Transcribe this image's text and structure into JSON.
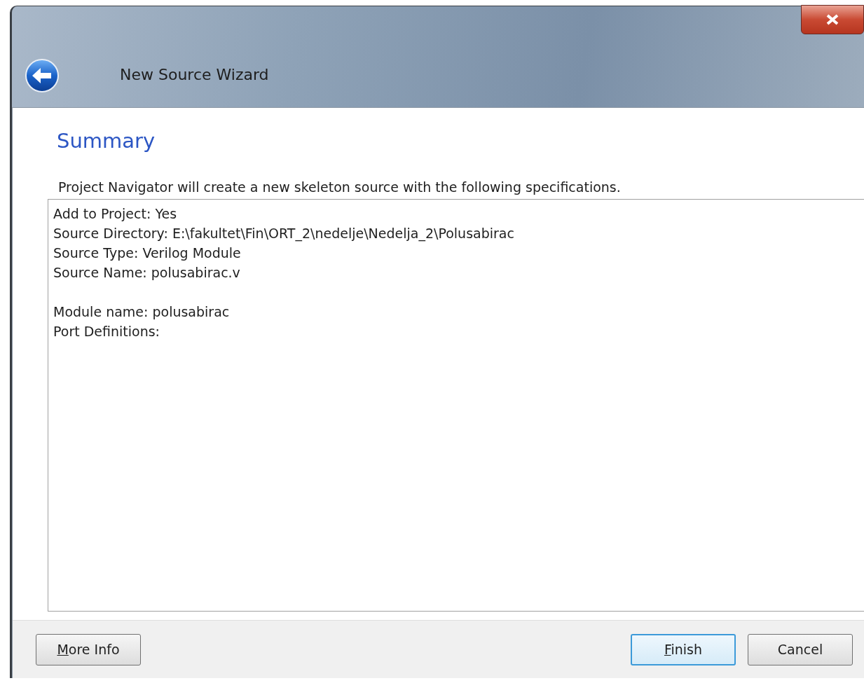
{
  "window": {
    "title": "New Source Wizard"
  },
  "page": {
    "heading": "Summary",
    "description": "Project Navigator will create a new skeleton source with the following specifications."
  },
  "summary_groups": [
    [
      "Add to Project: Yes",
      "Source Directory: E:\\fakultet\\Fin\\ORT_2\\nedelje\\Nedelja_2\\Polusabirac",
      "Source Type: Verilog Module",
      "Source Name: polusabirac.v"
    ],
    [
      "Module name: polusabirac",
      "Port Definitions:"
    ]
  ],
  "left_buttons": [
    {
      "label": "More Info",
      "underline_first": true,
      "default": false
    }
  ],
  "right_buttons": [
    {
      "label": "Finish",
      "underline_first": true,
      "default": true
    },
    {
      "label": "Cancel",
      "underline_first": false,
      "default": false
    }
  ]
}
